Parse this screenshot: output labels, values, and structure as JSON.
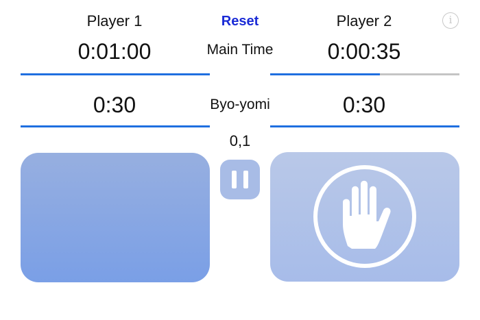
{
  "header": {
    "player1_label": "Player 1",
    "player2_label": "Player 2",
    "reset_label": "Reset",
    "info_glyph": "i"
  },
  "main_time": {
    "label": "Main Time",
    "player1": "0:01:00",
    "player2": "0:00:35",
    "player1_remaining_fraction": 1.0,
    "player2_remaining_fraction": 0.58
  },
  "byoyomi": {
    "label": "Byo-yomi",
    "player1": "0:30",
    "player2": "0:30",
    "period_count": "0,1"
  },
  "controls": {
    "left_pad_state": "active",
    "right_pad_icon": "stop-hand-icon",
    "pause_icon": "pause-icon"
  },
  "colors": {
    "accent_blue": "#1f6fe0",
    "bar_track": "#c4c4c4",
    "reset_text": "#1a2bd6",
    "pad_left": "#86a6e3",
    "pad_right": "#b0c3ea"
  }
}
